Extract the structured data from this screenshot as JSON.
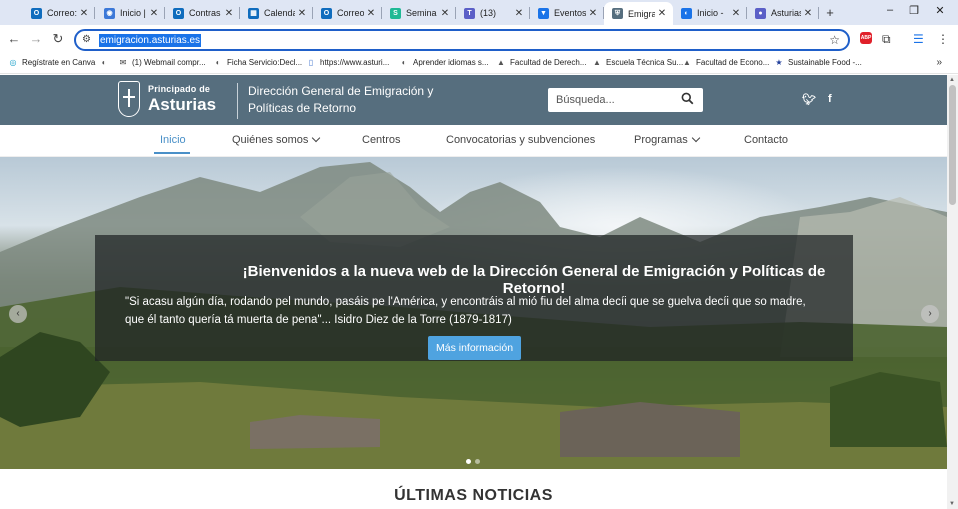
{
  "browser": {
    "tabs": [
      {
        "title": "Correo: ",
        "icon": "outlook-icon",
        "color": "#0f6cbd"
      },
      {
        "title": "Inicio | ",
        "icon": "chrome-web-icon",
        "color": "#3c78d8"
      },
      {
        "title": "Contras",
        "icon": "outlook-icon",
        "color": "#0f6cbd"
      },
      {
        "title": "Calenda",
        "icon": "outlook-calendar-icon",
        "color": "#0f6cbd"
      },
      {
        "title": "Correo ",
        "icon": "outlook-icon",
        "color": "#0f6cbd"
      },
      {
        "title": "Semina",
        "icon": "seminar-icon",
        "color": "#1fb995"
      },
      {
        "title": "(13)",
        "icon": "teams-icon",
        "color": "#5b5fc7"
      },
      {
        "title": "Eventos",
        "icon": "bookmark-icon",
        "color": "#1a73e8"
      },
      {
        "title": "Emigrac",
        "icon": "asturias-crest-icon",
        "color": "#566e7e",
        "active": true
      },
      {
        "title": "Inicio - ",
        "icon": "globe-icon",
        "color": "#1a73e8"
      },
      {
        "title": "Asturias",
        "icon": "asturias-icon",
        "color": "#5b5fc7"
      }
    ],
    "new_tab": "+",
    "window": {
      "minimize": "–",
      "restore": "❐",
      "close": "✕"
    },
    "url": "emigracion.asturias.es",
    "bookmarks": [
      {
        "label": "Regístrate en Canva",
        "icon": "canva-icon"
      },
      {
        "label": "",
        "icon": "globe-icon"
      },
      {
        "label": "(1) Webmail compr...",
        "icon": "mail-icon"
      },
      {
        "label": "Ficha Servicio:Decl...",
        "icon": "globe-icon"
      },
      {
        "label": "https://www.asturi...",
        "icon": "doc-icon"
      },
      {
        "label": "Aprender idiomas s...",
        "icon": "globe-icon"
      },
      {
        "label": "Facultad de Derech...",
        "icon": "university-icon"
      },
      {
        "label": "Escuela Técnica Su...",
        "icon": "university-icon"
      },
      {
        "label": "Facultad de Econo...",
        "icon": "university-icon"
      },
      {
        "label": "Sustainable Food -...",
        "icon": "eu-flag-icon"
      }
    ],
    "bookmarks_more": "»"
  },
  "site": {
    "logo_line1": "Principado de",
    "logo_line2": "Asturias",
    "title": "Dirección General de Emigración y Políticas de Retorno",
    "search_placeholder": "Búsqueda...",
    "nav": [
      {
        "label": "Inicio",
        "active": true
      },
      {
        "label": "Quiénes somos",
        "dropdown": true
      },
      {
        "label": "Centros"
      },
      {
        "label": "Convocatorias y subvenciones"
      },
      {
        "label": "Programas",
        "dropdown": true
      },
      {
        "label": "Contacto"
      }
    ],
    "hero": {
      "title": "¡Bienvenidos a la nueva web de la Dirección General de Emigración y Políticas de Retorno!",
      "quote": "\"Si acasu algún día, rodando pel mundo, pasáis pe l'América, y encontráis al mió fiu del alma decíi que se guelva decíi que so madre, que él tanto quería tá muerta de pena\"... Isidro Diez de la Torre (1879-1817)",
      "button": "Más información",
      "prev": "‹",
      "next": "›"
    },
    "news_heading": "ÚLTIMAS NOTICIAS"
  }
}
